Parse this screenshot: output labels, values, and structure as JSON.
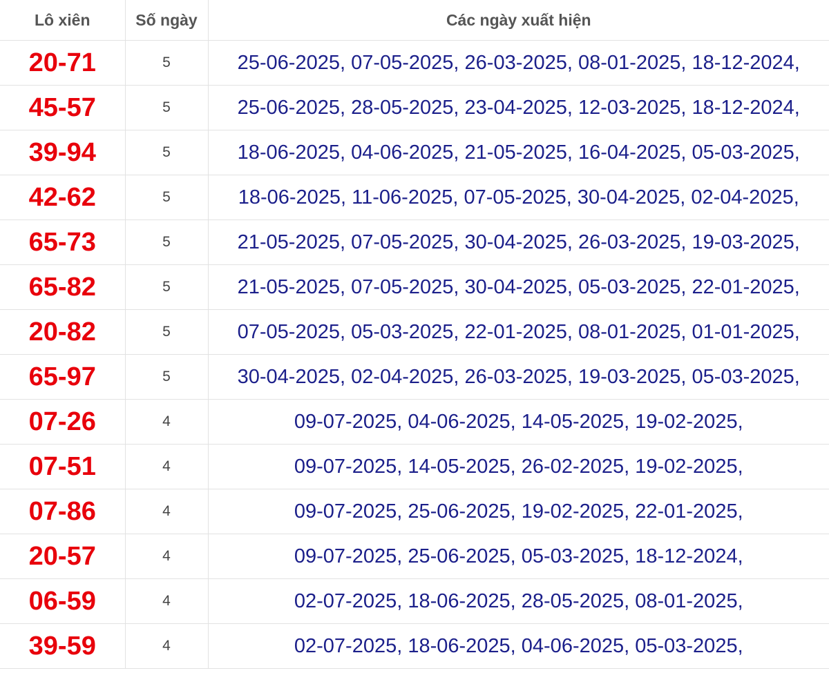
{
  "headers": {
    "pair": "Lô xiên",
    "days": "Số ngày",
    "dates": "Các ngày xuất hiện"
  },
  "colors": {
    "pair_text": "#e8000b",
    "dates_text": "#1b1f8a",
    "header_text": "#555555",
    "grid_line": "#e2e2e2"
  },
  "rows": [
    {
      "pair": "20-71",
      "days": "5",
      "dates": "25-06-2025, 07-05-2025, 26-03-2025, 08-01-2025, 18-12-2024,"
    },
    {
      "pair": "45-57",
      "days": "5",
      "dates": "25-06-2025, 28-05-2025, 23-04-2025, 12-03-2025, 18-12-2024,"
    },
    {
      "pair": "39-94",
      "days": "5",
      "dates": "18-06-2025, 04-06-2025, 21-05-2025, 16-04-2025, 05-03-2025,"
    },
    {
      "pair": "42-62",
      "days": "5",
      "dates": "18-06-2025, 11-06-2025, 07-05-2025, 30-04-2025, 02-04-2025,"
    },
    {
      "pair": "65-73",
      "days": "5",
      "dates": "21-05-2025, 07-05-2025, 30-04-2025, 26-03-2025, 19-03-2025,"
    },
    {
      "pair": "65-82",
      "days": "5",
      "dates": "21-05-2025, 07-05-2025, 30-04-2025, 05-03-2025, 22-01-2025,"
    },
    {
      "pair": "20-82",
      "days": "5",
      "dates": "07-05-2025, 05-03-2025, 22-01-2025, 08-01-2025, 01-01-2025,"
    },
    {
      "pair": "65-97",
      "days": "5",
      "dates": "30-04-2025, 02-04-2025, 26-03-2025, 19-03-2025, 05-03-2025,"
    },
    {
      "pair": "07-26",
      "days": "4",
      "dates": "09-07-2025, 04-06-2025, 14-05-2025, 19-02-2025,"
    },
    {
      "pair": "07-51",
      "days": "4",
      "dates": "09-07-2025, 14-05-2025, 26-02-2025, 19-02-2025,"
    },
    {
      "pair": "07-86",
      "days": "4",
      "dates": "09-07-2025, 25-06-2025, 19-02-2025, 22-01-2025,"
    },
    {
      "pair": "20-57",
      "days": "4",
      "dates": "09-07-2025, 25-06-2025, 05-03-2025, 18-12-2024,"
    },
    {
      "pair": "06-59",
      "days": "4",
      "dates": "02-07-2025, 18-06-2025, 28-05-2025, 08-01-2025,"
    },
    {
      "pair": "39-59",
      "days": "4",
      "dates": "02-07-2025, 18-06-2025, 04-06-2025, 05-03-2025,"
    }
  ]
}
